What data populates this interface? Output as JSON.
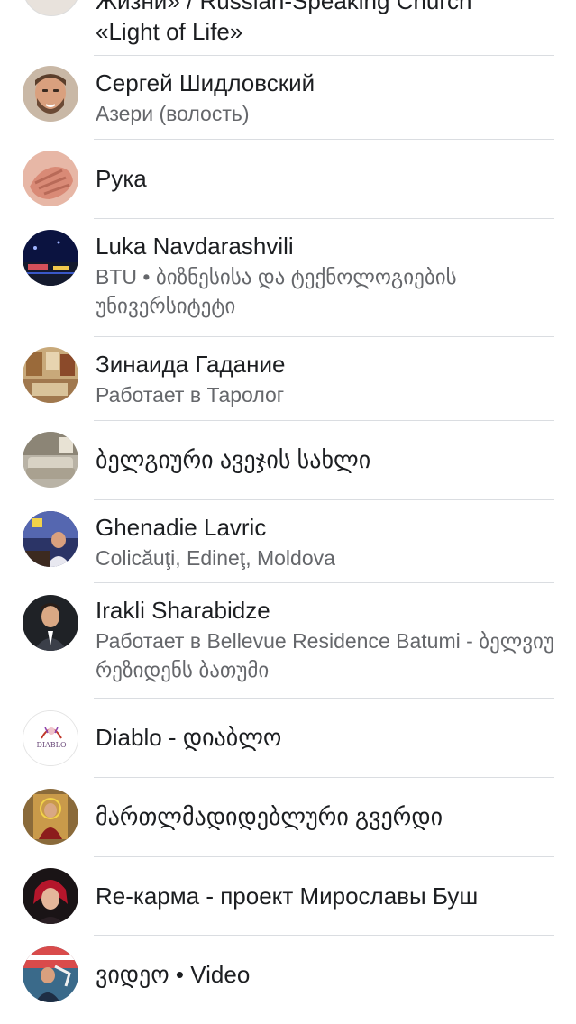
{
  "top_item": {
    "name_line1": "Жизни» / Russian-Speaking Church",
    "name_line2": "«Light of Life»"
  },
  "items": [
    {
      "name": "Сергей Шидловский",
      "subtitle": "Азери (волость)"
    },
    {
      "name": "Рука",
      "subtitle": ""
    },
    {
      "name": "Luka Navdarashvili",
      "subtitle": "BTU • ბიზნესისა და ტექნოლოგიების უნივერსიტეტი"
    },
    {
      "name": "Зинаида Гадание",
      "subtitle": "Работает в Таролог"
    },
    {
      "name": "ბელგიური ავეჯის სახლი",
      "subtitle": ""
    },
    {
      "name": "Ghenadie Lavric",
      "subtitle": "Colicăuţi, Edineţ, Moldova"
    },
    {
      "name": "Irakli Sharabidze",
      "subtitle": "Работает в Bellevue Residence Batumi - ბელვიუ რეზიდენს ბათუმი"
    },
    {
      "name": "Diablo - დიაბლო",
      "subtitle": "",
      "avatar_logo_text": "DIABLO"
    },
    {
      "name": "მართლმადიდებლური გვერდი",
      "subtitle": ""
    },
    {
      "name": "Re-карма - проект Мирославы Буш",
      "subtitle": ""
    },
    {
      "name": "ვიდეო • Video",
      "subtitle": ""
    }
  ]
}
